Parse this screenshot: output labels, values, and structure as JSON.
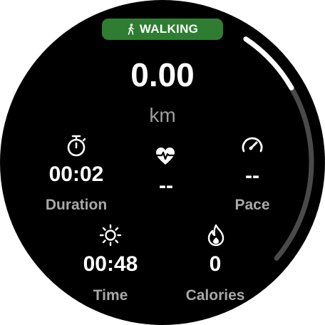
{
  "activity": {
    "icon": "walking-person-icon",
    "label": "WALKING",
    "color": "#2e7d32"
  },
  "distance": {
    "value": "0.00",
    "unit": "km"
  },
  "duration": {
    "icon": "stopwatch-icon",
    "value": "00:02",
    "label": "Duration"
  },
  "heart_rate": {
    "icon": "heart-rate-icon",
    "value": "--"
  },
  "pace": {
    "icon": "speedometer-icon",
    "value": "--",
    "label": "Pace"
  },
  "time": {
    "icon": "sun-icon",
    "value": "00:48",
    "label": "Time"
  },
  "calories": {
    "icon": "flame-icon",
    "value": "0",
    "label": "Calories"
  },
  "scroll": {
    "position": 0.2
  }
}
